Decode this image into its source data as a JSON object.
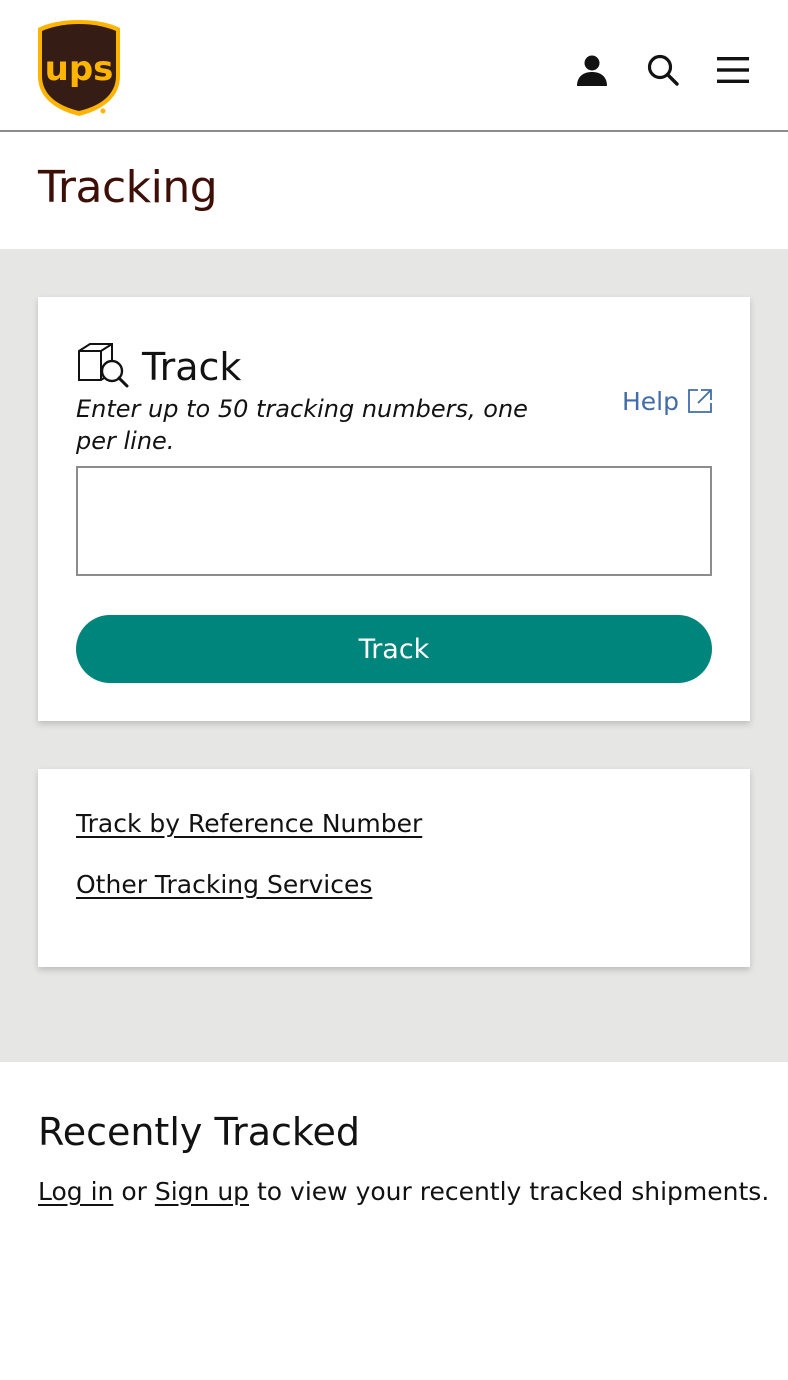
{
  "header": {
    "logo_text": "ups",
    "icons": [
      "user-icon",
      "search-icon",
      "menu-icon"
    ]
  },
  "page": {
    "title": "Tracking"
  },
  "track_card": {
    "icon": "package-search-icon",
    "heading": "Track",
    "instructions": "Enter up to 50 tracking numbers, one per line.",
    "help_label": "Help",
    "help_icon": "external-link-icon",
    "input_value": "",
    "button_label": "Track"
  },
  "links_card": {
    "items": [
      {
        "label": "Track by Reference Number"
      },
      {
        "label": "Other Tracking Services"
      }
    ]
  },
  "recently_tracked": {
    "title": "Recently Tracked",
    "login_label": "Log in",
    "or_text": " or ",
    "signup_label": "Sign up",
    "suffix_text": " to view your recently tracked shipments."
  },
  "colors": {
    "brand_brown": "#351c15",
    "brand_gold": "#ffb500",
    "title_brown": "#3d0f06",
    "accent_teal": "#00857d",
    "link_blue": "#426da9",
    "band_grey": "#e6e6e5"
  }
}
